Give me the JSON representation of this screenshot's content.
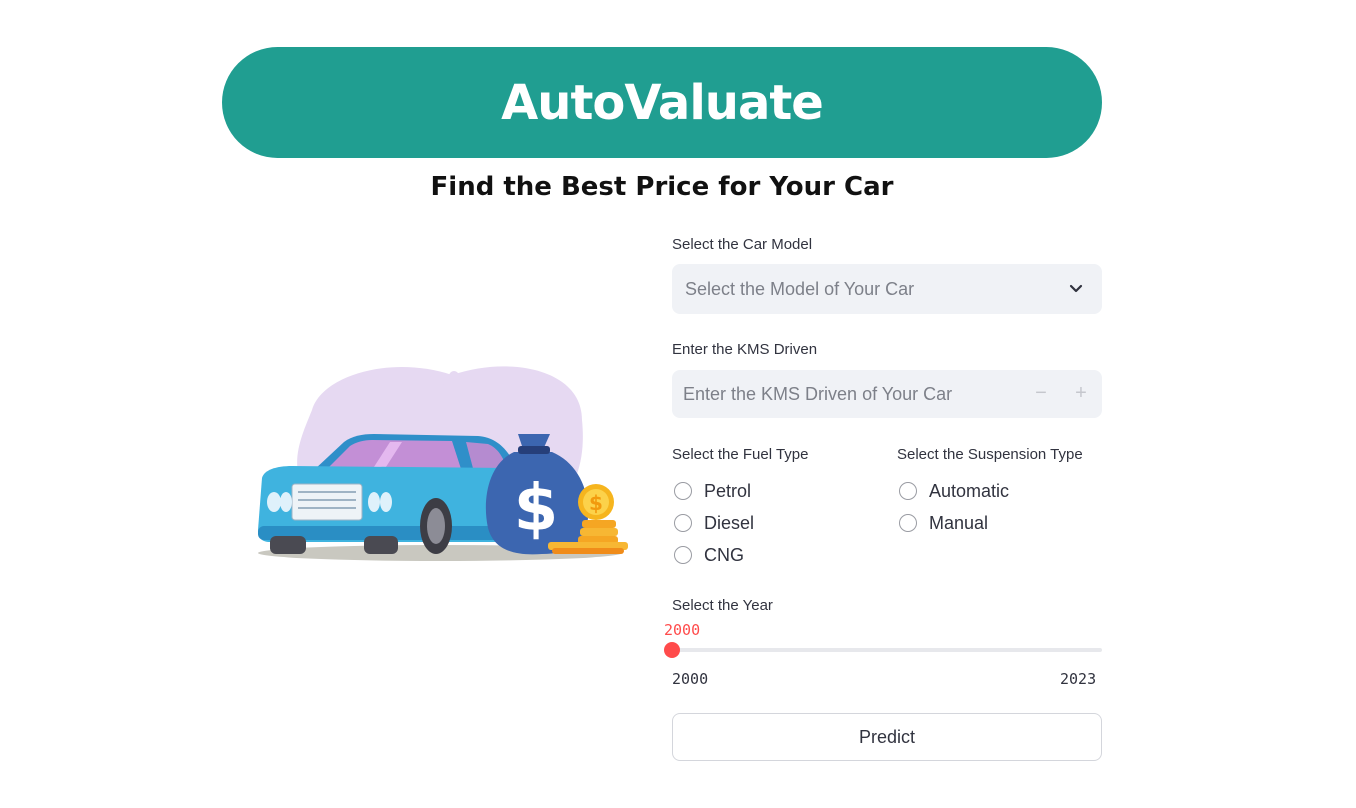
{
  "header": {
    "title": "AutoValuate",
    "subtitle": "Find the Best Price for Your Car"
  },
  "form": {
    "car_model": {
      "label": "Select the Car Model",
      "placeholder": "Select the Model of Your Car"
    },
    "kms": {
      "label": "Enter the KMS Driven",
      "placeholder": "Enter the KMS Driven of Your Car",
      "decrement": "−",
      "increment": "+"
    },
    "fuel": {
      "label": "Select the Fuel Type",
      "options": [
        "Petrol",
        "Diesel",
        "CNG"
      ]
    },
    "suspension": {
      "label": "Select the Suspension Type",
      "options": [
        "Automatic",
        "Manual"
      ]
    },
    "year": {
      "label": "Select the Year",
      "value": "2000",
      "min": "2000",
      "max": "2023",
      "fraction": 0
    },
    "predict_label": "Predict"
  },
  "colors": {
    "brand": "#209e91",
    "accent": "#ff4b4b",
    "input_bg": "#f0f2f6"
  },
  "illustration": {
    "dollar_symbol": "$"
  }
}
